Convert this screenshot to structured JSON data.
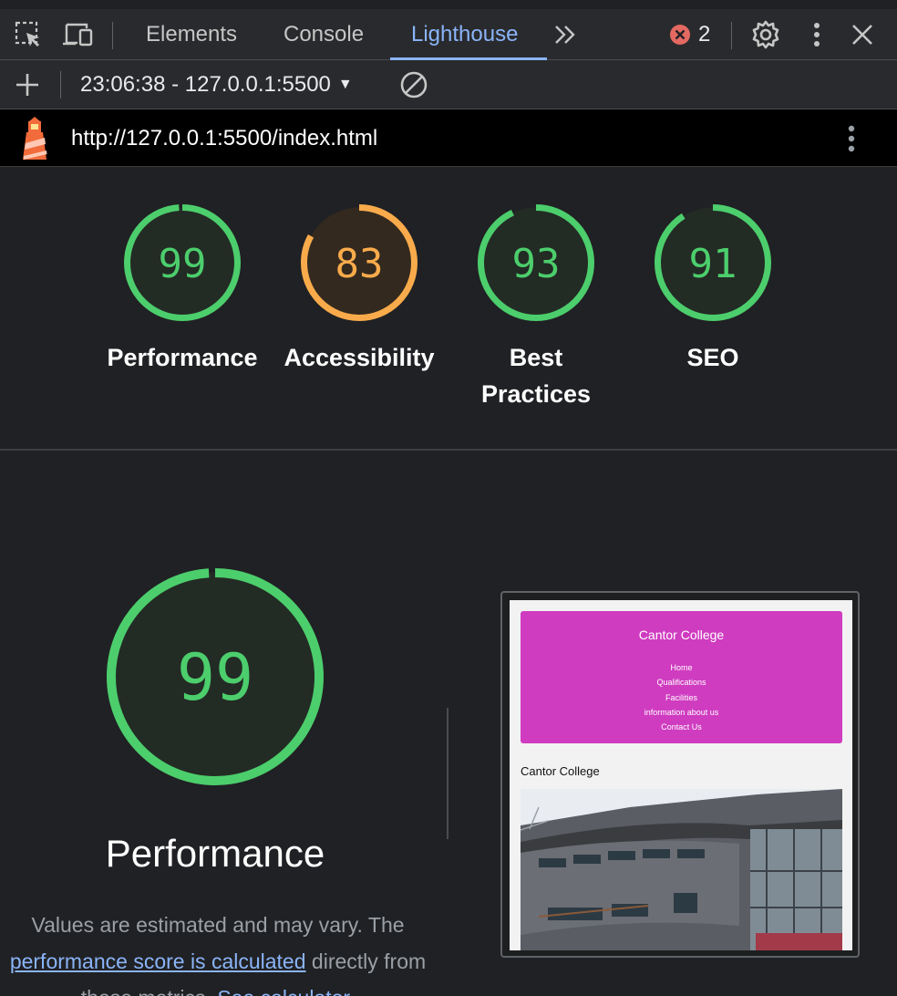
{
  "devtools": {
    "tabs": [
      {
        "label": "Elements"
      },
      {
        "label": "Console"
      },
      {
        "label": "Lighthouse"
      }
    ],
    "active_tab": "Lighthouse",
    "more_tabs_glyph": "»",
    "error_count": "2",
    "icons": [
      "inspect-element-icon",
      "device-toggle-icon",
      "more-tabs-icon",
      "error-icon",
      "settings-gear-icon",
      "kebab-menu-icon",
      "close-icon"
    ],
    "accent_color": "#8ab4f8"
  },
  "lighthouse_toolbar": {
    "report_select": "23:06:38 - 127.0.0.1:5500",
    "icons": [
      "add-icon",
      "dropdown-caret-icon",
      "clear-icon"
    ]
  },
  "urlbar": {
    "url": "http://127.0.0.1:5500/index.html",
    "icons": [
      "lighthouse-logo-icon",
      "url-menu-icon"
    ]
  },
  "scores": [
    {
      "label": "Performance",
      "score": 99,
      "color": "#4cce6c"
    },
    {
      "label": "Accessibility",
      "score": 83,
      "color": "#f9ab4b"
    },
    {
      "label_lines": [
        "Best",
        "Practices"
      ],
      "score": 93,
      "color": "#4cce6c"
    },
    {
      "label": "SEO",
      "score": 91,
      "color": "#4cce6c"
    }
  ],
  "performance_detail": {
    "score": 99,
    "label": "Performance",
    "desc_line1": "Values are estimated and may vary. The",
    "desc_link": "performance score is calculated",
    "desc_line2": "directly from",
    "desc_line3": "these metrics.",
    "desc_link2": "See calculator."
  },
  "thumbnail": {
    "site_title": "Cantor College",
    "nav": [
      "Home",
      "Qualifications",
      "Facilities",
      "information about us",
      "Contact Us"
    ],
    "heading": "Cantor College",
    "header_color": "#cf3cc0"
  }
}
